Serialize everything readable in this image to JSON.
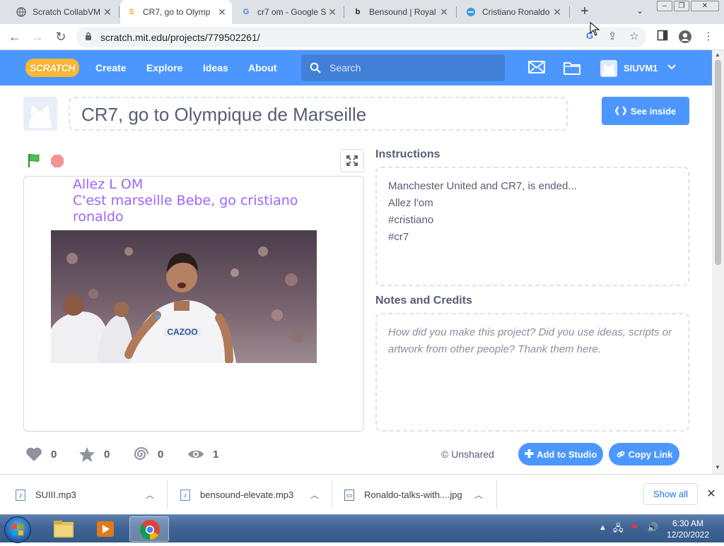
{
  "browser": {
    "tabs": [
      {
        "title": "Scratch CollabVM",
        "favicon": "globe-icon"
      },
      {
        "title": "CR7, go to Olymp",
        "favicon": "scratch-icon"
      },
      {
        "title": "cr7 om - Google S",
        "favicon": "google-icon"
      },
      {
        "title": "Bensound | Royal",
        "favicon": "bensound-icon"
      },
      {
        "title": "Cristiano Ronaldo",
        "favicon": "site-icon"
      }
    ],
    "url": "scratch.mit.edu/projects/779502261/"
  },
  "scratch_nav": {
    "logo": "SCRATCH",
    "links": [
      "Create",
      "Explore",
      "Ideas",
      "About"
    ],
    "search_placeholder": "Search",
    "username": "SIUVM1"
  },
  "project": {
    "title": "CR7, go to Olympique de Marseille",
    "see_inside": "See inside",
    "stage_text_line1": "Allez L OM",
    "stage_text_line2": "C'est marseille Bebe, go cristiano ronaldo",
    "photo_sponsor": "CAZOO"
  },
  "instructions": {
    "heading": "Instructions",
    "lines": [
      "Manchester United and CR7, is ended...",
      "Allez l'om",
      "#cristiano",
      "#cr7"
    ]
  },
  "notes": {
    "heading": "Notes and Credits",
    "placeholder": "How did you make this project? Did you use ideas, scripts or artwork from other people? Thank them here."
  },
  "stats": {
    "loves": "0",
    "favorites": "0",
    "remixes": "0",
    "views": "1",
    "unshared": "Unshared",
    "add_to_studio": "Add to Studio",
    "copy_link": "Copy Link"
  },
  "downloads": {
    "items": [
      "SUIII.mp3",
      "bensound-elevate.mp3",
      "Ronaldo-talks-with....jpg"
    ],
    "show_all": "Show all"
  },
  "taskbar": {
    "time": "6:30 AM",
    "date": "12/20/2022"
  },
  "colors": {
    "scratch_blue": "#4c97ff",
    "text_gray": "#575e75",
    "stage_text_purple": "#9966ff"
  }
}
